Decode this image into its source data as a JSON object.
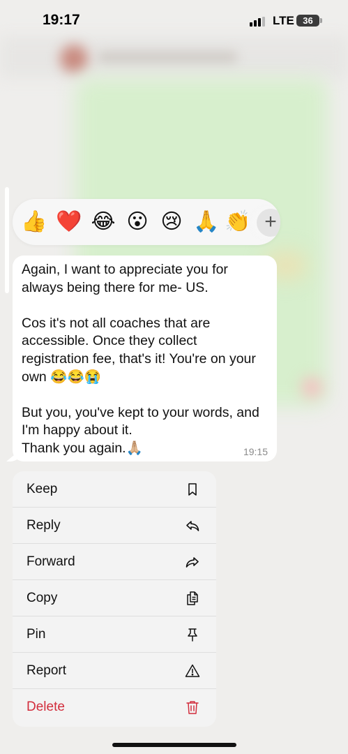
{
  "status_bar": {
    "time": "19:17",
    "network": "LTE",
    "battery": "36",
    "signal_bars_filled": 3
  },
  "reactions": [
    {
      "icon": "thumbs-up",
      "glyph": "👍"
    },
    {
      "icon": "red-heart",
      "glyph": "❤️"
    },
    {
      "icon": "face-with-tears-of-joy",
      "glyph": "😂"
    },
    {
      "icon": "face-with-open-mouth",
      "glyph": "😮"
    },
    {
      "icon": "crying-face",
      "glyph": "😢"
    },
    {
      "icon": "folded-hands",
      "glyph": "🙏"
    },
    {
      "icon": "clapping-hands",
      "glyph": "👏"
    }
  ],
  "add_reaction_icon": "plus-icon",
  "message": {
    "lines": [
      "Again, I want to appreciate you for",
      "always being there for me- US.",
      "",
      "Cos it's not all coaches that are",
      "accessible. Once they collect",
      "registration fee, that's it! You're on your",
      "own 😂😂😭",
      "",
      "But you, you've kept to your words, and",
      "I'm happy about it.",
      "Thank you again.🙏🏼"
    ],
    "time": "19:15"
  },
  "menu": {
    "items": [
      {
        "label": "Keep",
        "icon": "bookmark-icon"
      },
      {
        "label": "Reply",
        "icon": "reply-icon"
      },
      {
        "label": "Forward",
        "icon": "forward-icon"
      },
      {
        "label": "Copy",
        "icon": "copy-icon"
      },
      {
        "label": "Pin",
        "icon": "pin-icon"
      },
      {
        "label": "Report",
        "icon": "warning-icon"
      },
      {
        "label": "Delete",
        "icon": "trash-icon"
      }
    ]
  },
  "colors": {
    "delete": "#d22d3c",
    "bubble": "#ffffff",
    "menu_background": "#f3f3f3"
  }
}
